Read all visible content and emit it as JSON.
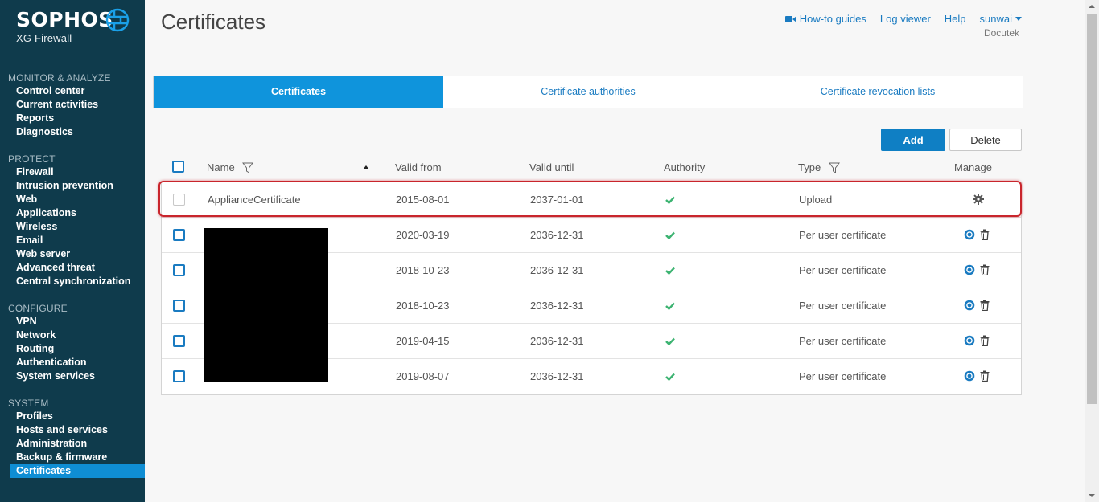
{
  "brand": {
    "name": "SOPHOS",
    "product": "XG Firewall"
  },
  "sidebar": {
    "groups": [
      {
        "title": "MONITOR & ANALYZE",
        "items": [
          "Control center",
          "Current activities",
          "Reports",
          "Diagnostics"
        ]
      },
      {
        "title": "PROTECT",
        "items": [
          "Firewall",
          "Intrusion prevention",
          "Web",
          "Applications",
          "Wireless",
          "Email",
          "Web server",
          "Advanced threat",
          "Central synchronization"
        ]
      },
      {
        "title": "CONFIGURE",
        "items": [
          "VPN",
          "Network",
          "Routing",
          "Authentication",
          "System services"
        ]
      },
      {
        "title": "SYSTEM",
        "items": [
          "Profiles",
          "Hosts and services",
          "Administration",
          "Backup & firmware",
          "Certificates"
        ]
      }
    ],
    "active": "Certificates"
  },
  "header": {
    "title": "Certificates",
    "links": {
      "howto": "How-to guides",
      "log": "Log viewer",
      "help": "Help",
      "user": "sunwai"
    },
    "org": "Docutek"
  },
  "tabs": [
    "Certificates",
    "Certificate authorities",
    "Certificate revocation lists"
  ],
  "toolbar": {
    "add": "Add",
    "delete": "Delete"
  },
  "table": {
    "columns": {
      "name": "Name",
      "valid_from": "Valid from",
      "valid_until": "Valid until",
      "authority": "Authority",
      "type": "Type",
      "manage": "Manage"
    },
    "rows": [
      {
        "name": "ApplianceCertificate",
        "valid_from": "2015-08-01",
        "valid_until": "2037-01-01",
        "type": "Upload"
      },
      {
        "name": "",
        "valid_from": "2020-03-19",
        "valid_until": "2036-12-31",
        "type": "Per user certificate"
      },
      {
        "name": "",
        "valid_from": "2018-10-23",
        "valid_until": "2036-12-31",
        "type": "Per user certificate"
      },
      {
        "name": "",
        "valid_from": "2018-10-23",
        "valid_until": "2036-12-31",
        "type": "Per user certificate"
      },
      {
        "name": "",
        "valid_from": "2019-04-15",
        "valid_until": "2036-12-31",
        "type": "Per user certificate"
      },
      {
        "name": "",
        "valid_from": "2019-08-07",
        "valid_until": "2036-12-31",
        "type": "Per user certificate"
      }
    ]
  },
  "colors": {
    "sidebar": "#0f3b4c",
    "accent": "#0f94dc",
    "link": "#1a7bc1",
    "check": "#3cb371",
    "highlight": "#c9252c"
  }
}
